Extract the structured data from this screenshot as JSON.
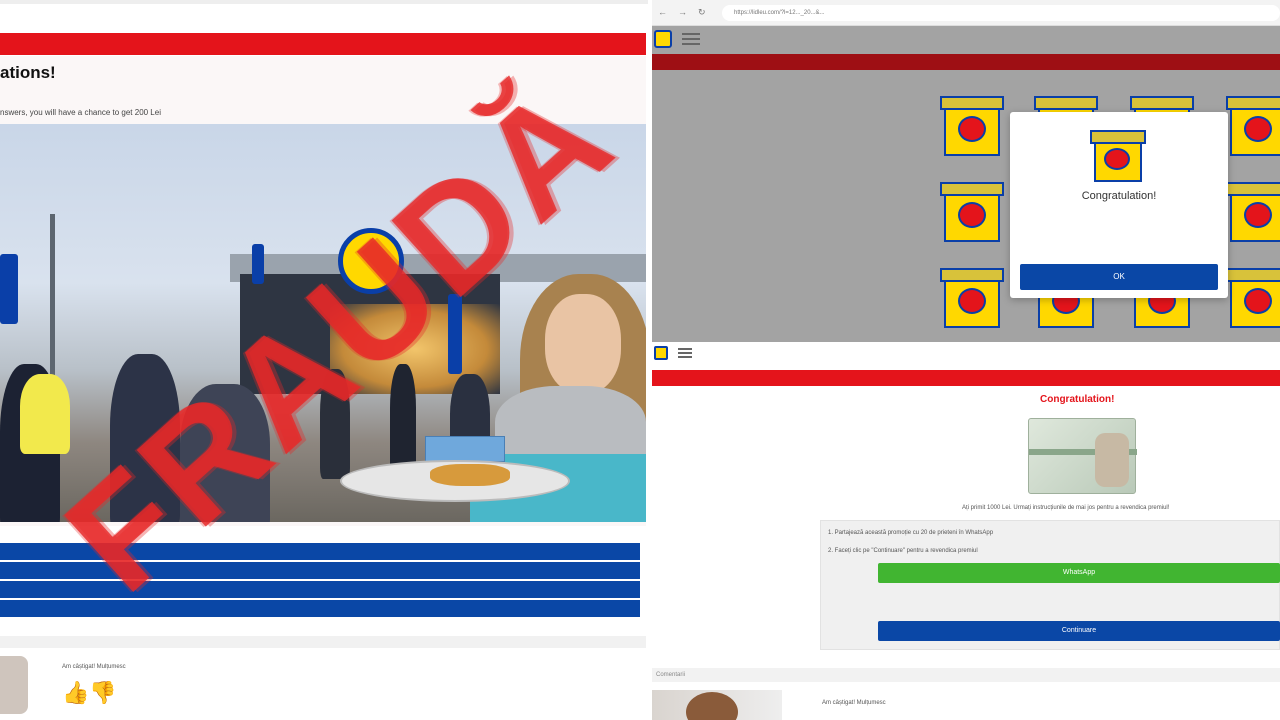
{
  "left": {
    "redbar_label": "",
    "title": "ations!",
    "subtitle": "nswers, you will have a chance to get 200 Lei",
    "stamp_text": "FRAUDĂ",
    "answer_buttons": [
      "",
      "",
      "",
      ""
    ],
    "comment_text": "Am câștigat! Mulțumesc"
  },
  "right": {
    "url": "https://lidleu.com/?l=12..._20...&...",
    "modal_title": "Congratulation!",
    "modal_ok": "OK",
    "congrats": "Congratulation!",
    "info_text": "Ați primit 1000 Lei. Urmați instrucțiunile de mai jos pentru a revendica premiul!",
    "step1": "1. Partajează această promoție cu 20 de prieteni în WhatsApp",
    "step2": "2. Faceți clic pe \"Continuare\" pentru a revendica premiul",
    "whatsapp_label": "WhatsApp",
    "continue_label": "Continuare",
    "comments_label": "Comentarii",
    "comment_text": "Am câștigat! Mulțumesc"
  },
  "colors": {
    "lidl_red": "#e4141b",
    "lidl_blue": "#0a47a6",
    "lidl_yellow": "#ffd800",
    "whatsapp_green": "#41b531",
    "stamp_red": "#e62828"
  }
}
